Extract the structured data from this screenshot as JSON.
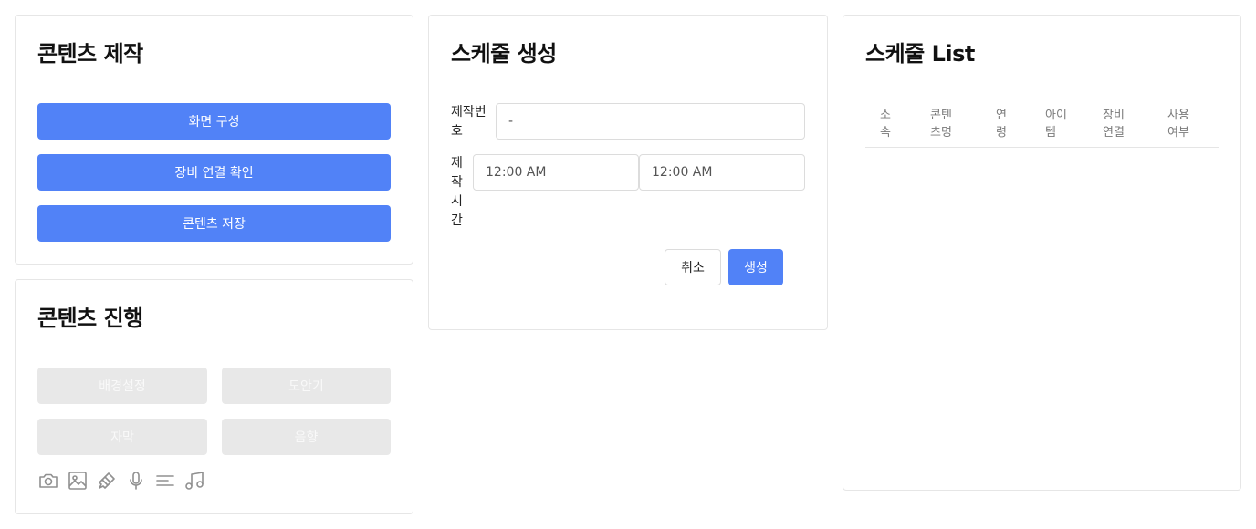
{
  "production": {
    "title": "콘텐츠 제작",
    "buttons": [
      "화면 구성",
      "장비 연결 확인",
      "콘텐츠 저장"
    ]
  },
  "progress": {
    "title": "콘텐츠 진행",
    "buttons": [
      "배경설정",
      "도안기",
      "자막",
      "음향"
    ],
    "icons": [
      "camera-icon",
      "image-icon",
      "brush-icon",
      "microphone-icon",
      "text-lines-icon",
      "music-icon"
    ]
  },
  "schedule_create": {
    "title": "스케줄 생성",
    "production_number_label": "제작번\n호",
    "production_number_value": "-",
    "production_time_label": "제\n작\n시\n간",
    "start_time": "12:00 AM",
    "end_time": "12:00 AM",
    "cancel_label": "취소",
    "create_label": "생성"
  },
  "schedule_list": {
    "title": "스케줄 List",
    "columns": [
      "소\n속",
      "콘텐\n츠명",
      "연\n령",
      "아이\n템",
      "장비\n연결",
      "사용\n여부"
    ]
  },
  "colors": {
    "primary": "#5182f7",
    "disabled": "#e8e8e8",
    "border": "#e6e6e6"
  }
}
